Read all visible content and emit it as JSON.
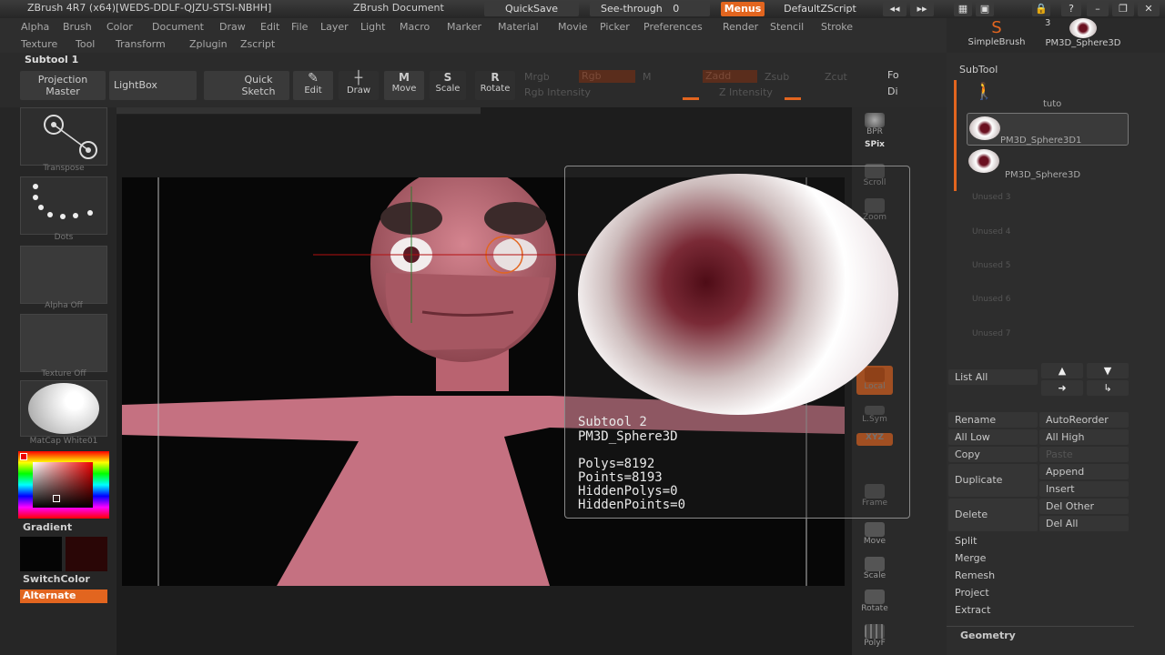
{
  "titlebar": {
    "app_title": "ZBrush 4R7 (x64)[WEDS-DDLF-QJZU-STSI-NBHH]",
    "document": "ZBrush Document",
    "quicksave": "QuickSave",
    "seethrough": "See-through",
    "seethrough_value": "0",
    "menus": "Menus",
    "script": "DefaultZScript"
  },
  "menus": {
    "row1": [
      "Alpha",
      "Brush",
      "Color",
      "Document",
      "Draw",
      "Edit",
      "File",
      "Layer",
      "Light",
      "Macro",
      "Marker",
      "Material",
      "Movie",
      "Picker",
      "Preferences",
      "Render",
      "Stencil",
      "Stroke"
    ],
    "row2": [
      "Texture",
      "Tool",
      "Transform",
      "Zplugin",
      "Zscript"
    ]
  },
  "subtool_label": "Subtool 1",
  "toolbar": {
    "projection": "Projection",
    "master": "Master",
    "lightbox": "LightBox",
    "quick": "Quick",
    "sketch": "Sketch",
    "edit": "Edit",
    "draw": "Draw",
    "move": "Move",
    "scale": "Scale",
    "rotate": "Rotate",
    "mrgb": "Mrgb",
    "rgb": "Rgb",
    "m": "M",
    "zadd": "Zadd",
    "zsub": "Zsub",
    "zcut": "Zcut",
    "fo": "Fo",
    "rgb_intensity": "Rgb Intensity",
    "z_intensity": "Z Intensity",
    "di": "Di"
  },
  "left_shelf": {
    "transpose": "Transpose",
    "dots": "Dots",
    "alpha_off": "Alpha  Off",
    "texture_off": "Texture  Off",
    "matcap": "MatCap  White01",
    "gradient": "Gradient",
    "switchcolor": "SwitchColor",
    "alternate": "Alternate"
  },
  "right_shelf": [
    "BPR",
    "SPix",
    "Scroll",
    "Zoom",
    "Local",
    "L.Sym",
    "XYZ",
    "Frame",
    "Move",
    "Scale",
    "Rotate",
    "PolyF"
  ],
  "popup": {
    "line1": "Subtool 2",
    "line2": "PM3D_Sphere3D",
    "line3": "Polys=8192",
    "line4": "Points=8193",
    "line5": "HiddenPolys=0",
    "line6": "HiddenPoints=0"
  },
  "tool_panel": {
    "simplebrush": "SimpleBrush",
    "count": "3",
    "sphere": "PM3D_Sphere3D",
    "subtool_header": "SubTool",
    "items": [
      "tuto",
      "PM3D_Sphere3D1",
      "PM3D_Sphere3D"
    ],
    "unused": [
      "Unused 3",
      "Unused 4",
      "Unused 5",
      "Unused 6",
      "Unused 7"
    ],
    "list_all": "List  All",
    "buttons": {
      "rename": "Rename",
      "autoreorder": "AutoReorder",
      "all_low": "All Low",
      "all_high": "All High",
      "copy": "Copy",
      "paste": "Paste",
      "duplicate": "Duplicate",
      "append": "Append",
      "insert": "Insert",
      "delete": "Delete",
      "del_other": "Del Other",
      "del_all": "Del All",
      "split": "Split",
      "merge": "Merge",
      "remesh": "Remesh",
      "project": "Project",
      "extract": "Extract",
      "geometry": "Geometry"
    }
  },
  "colors": {
    "accent": "#e2651f",
    "skin": "#c96f7d",
    "background": "#2a2a2a"
  }
}
